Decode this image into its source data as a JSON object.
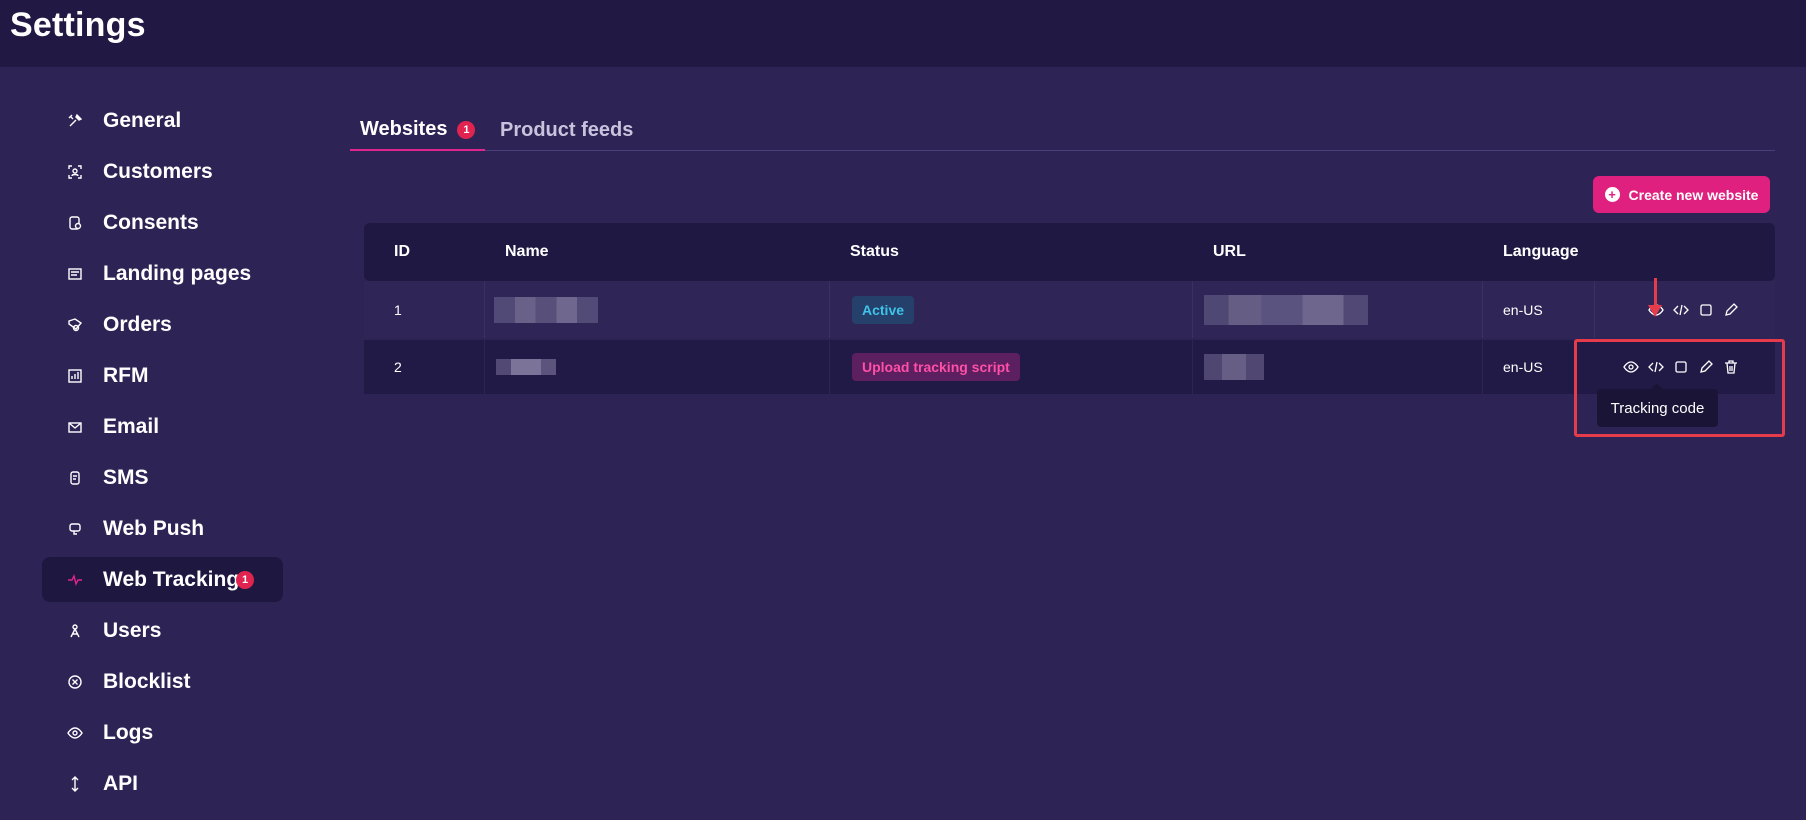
{
  "page": {
    "title": "Settings"
  },
  "sidebar": {
    "items": [
      {
        "label": "General",
        "icon": "tools-icon"
      },
      {
        "label": "Customers",
        "icon": "customer-icon"
      },
      {
        "label": "Consents",
        "icon": "consent-icon"
      },
      {
        "label": "Landing pages",
        "icon": "landing-page-icon"
      },
      {
        "label": "Orders",
        "icon": "orders-icon"
      },
      {
        "label": "RFM",
        "icon": "rfm-chart-icon"
      },
      {
        "label": "Email",
        "icon": "email-icon"
      },
      {
        "label": "SMS",
        "icon": "sms-icon"
      },
      {
        "label": "Web Push",
        "icon": "web-push-icon"
      },
      {
        "label": "Web Tracking",
        "icon": "pulse-icon",
        "active": true,
        "badge": "1"
      },
      {
        "label": "Users",
        "icon": "users-icon"
      },
      {
        "label": "Blocklist",
        "icon": "block-icon"
      },
      {
        "label": "Logs",
        "icon": "eye-icon"
      },
      {
        "label": "API",
        "icon": "api-arrows-icon"
      }
    ]
  },
  "tabs": [
    {
      "label": "Websites",
      "badge": "1",
      "active": true
    },
    {
      "label": "Product feeds",
      "active": false
    }
  ],
  "toolbar": {
    "create_label": "Create new website"
  },
  "table": {
    "headers": [
      "ID",
      "Name",
      "Status",
      "URL",
      "Language"
    ],
    "rows": [
      {
        "id": "1",
        "status": "Active",
        "language": "en-US"
      },
      {
        "id": "2",
        "status": "Upload tracking script",
        "language": "en-US"
      }
    ]
  },
  "tooltip": {
    "text": "Tracking code"
  },
  "colors": {
    "background": "#2d2354",
    "topbar": "#211943",
    "accent": "#e0207f",
    "badge": "#e0244f",
    "status_active": "#3fc3e8",
    "status_upload": "#ff4fa7",
    "annotation": "#e53b4a"
  }
}
